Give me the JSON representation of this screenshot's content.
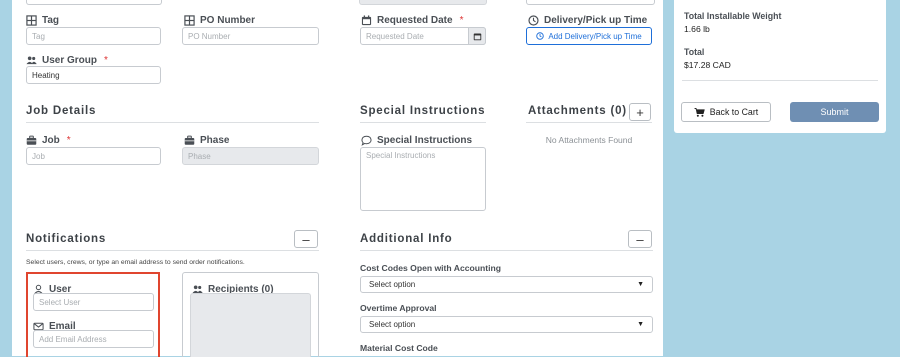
{
  "fields": {
    "tag": {
      "label": "Tag",
      "placeholder": "Tag"
    },
    "po_number": {
      "label": "PO Number",
      "placeholder": "PO Number"
    },
    "requested_date": {
      "label": "Requested Date",
      "required": "*",
      "placeholder": "Requested Date"
    },
    "delivery_time": {
      "label": "Delivery/Pick up Time",
      "button_label": "Add Delivery/Pick up Time"
    },
    "user_group": {
      "label": "User Group",
      "required": "*",
      "value": "Heating"
    }
  },
  "job_details": {
    "title": "Job Details",
    "job": {
      "label": "Job",
      "required": "*",
      "placeholder": "Job"
    },
    "phase": {
      "label": "Phase",
      "placeholder": "Phase"
    }
  },
  "special_instructions": {
    "title": "Special Instructions",
    "field_label": "Special Instructions",
    "placeholder": "Special Instructions"
  },
  "attachments": {
    "title": "Attachments (0)",
    "add_label": "+",
    "empty_text": "No Attachments Found"
  },
  "notifications": {
    "title": "Notifications",
    "collapse_label": "–",
    "description": "Select users, crews, or type an email address to send order notifications.",
    "user": {
      "label": "User",
      "placeholder": "Select User"
    },
    "email": {
      "label": "Email",
      "placeholder": "Add Email Address"
    },
    "recipients": {
      "label": "Recipients (0)"
    }
  },
  "additional_info": {
    "title": "Additional Info",
    "collapse_label": "–",
    "cost_codes": {
      "label": "Cost Codes Open with Accounting",
      "value": "Select option"
    },
    "overtime": {
      "label": "Overtime Approval",
      "value": "Select option"
    },
    "material_cost_code": {
      "label": "Material Cost Code"
    }
  },
  "summary": {
    "installable_weight_label": "Total Installable Weight",
    "installable_weight_value": "1.66 lb",
    "total_label": "Total",
    "total_value": "$17.28 CAD",
    "back_to_cart_label": "Back to Cart",
    "submit_label": "Submit"
  },
  "colors": {
    "page_background": "#a9d3e4",
    "link_blue": "#1e6fd9",
    "submit_button": "#6f8fb3",
    "highlight_border": "#e0452f",
    "required_marker": "#dd3333"
  }
}
